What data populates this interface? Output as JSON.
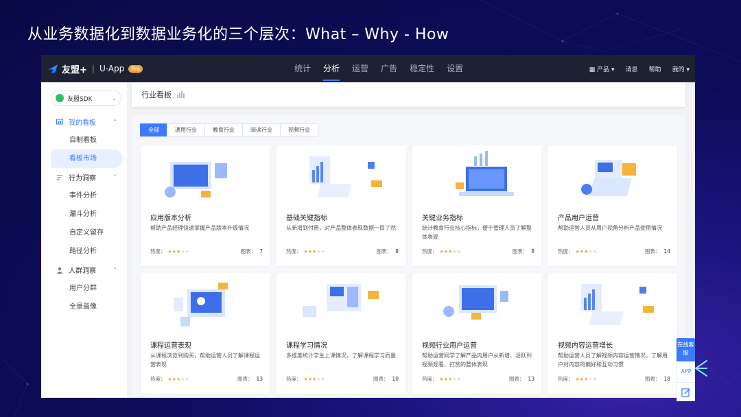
{
  "slide": {
    "title": "从业务数据化到数据业务化的三个层次：What – Why - How"
  },
  "app": {
    "brand": "友盟+",
    "separator": "|",
    "product": "U-App",
    "badge": "Pro",
    "nav": [
      "统计",
      "分析",
      "运营",
      "广告",
      "稳定性",
      "设置"
    ],
    "active_nav": "分析",
    "right_nav": {
      "product": "产品",
      "messages": "消息",
      "help": "帮助",
      "mine": "我的"
    }
  },
  "sidebar": {
    "sdk_select": "友盟SDK",
    "groups": [
      {
        "label": "我的看板",
        "items": [
          "自制看板",
          "看板市场"
        ]
      },
      {
        "label": "行为洞察",
        "items": [
          "事件分析",
          "漏斗分析",
          "自定义留存",
          "路径分析"
        ]
      },
      {
        "label": "人群洞察",
        "items": [
          "用户分群",
          "全景画像"
        ]
      }
    ],
    "active_item": "看板市场"
  },
  "page": {
    "title": "行业看板"
  },
  "tabs": [
    "全部",
    "通用行业",
    "教育行业",
    "阅读行业",
    "视频行业"
  ],
  "active_tab": "全部",
  "card_labels": {
    "heat": "热度：",
    "charts": "图表："
  },
  "cards": [
    {
      "title": "应用版本分析",
      "desc": "帮助产品经理快速掌握产品版本升级情况",
      "heat": 3,
      "charts": "7"
    },
    {
      "title": "基础关键指标",
      "desc": "从新增到付费，对产品整体表现数据一目了然",
      "heat": 3,
      "charts": "8"
    },
    {
      "title": "关键业务指标",
      "desc": "统计教育行业核心指标，便于管理人员了解整体表现",
      "heat": 3,
      "charts": "8"
    },
    {
      "title": "产品用户运营",
      "desc": "帮助运营人员从用户视角分析产品使用情况",
      "heat": 3,
      "charts": "14"
    },
    {
      "title": "课程运营表现",
      "desc": "从课程浏览到购买，帮助运营人员了解课程运营表现",
      "heat": 3,
      "charts": "13"
    },
    {
      "title": "课程学习情况",
      "desc": "多维度统计学生上课情况，了解课程学习质量",
      "heat": 3,
      "charts": "10"
    },
    {
      "title": "视频行业用户运营",
      "desc": "帮助运营同学了解产品内用户从新增、活跃到视频观看、打赏的整体表现",
      "heat": 3,
      "charts": "13"
    },
    {
      "title": "视频内容运营增长",
      "desc": "帮助运营人员了解视频内容运营情况，了解用户对内容的偏好和互动习惯",
      "heat": 3,
      "charts": "18"
    }
  ],
  "float_bar": {
    "online": "在线客服",
    "app": "APP"
  },
  "colors": {
    "accent": "#3c7bff",
    "topbar": "#1d2232",
    "star": "#f5a623"
  }
}
